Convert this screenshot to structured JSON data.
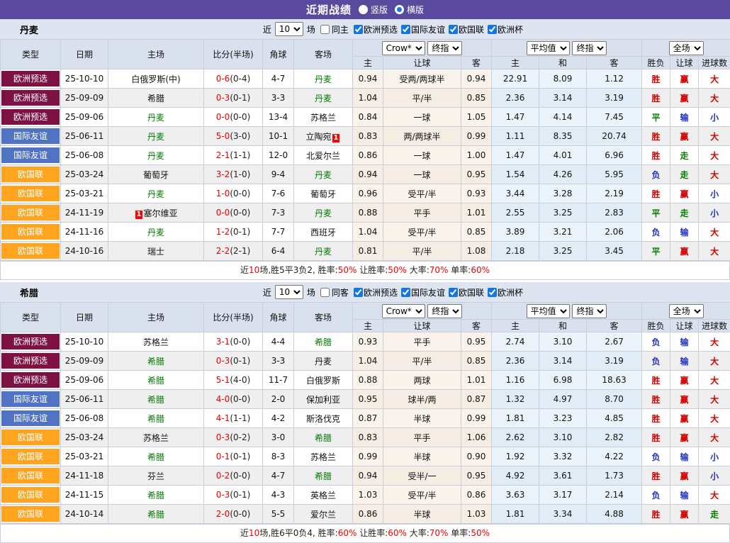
{
  "topbar": {
    "title": "近期战绩",
    "vertical_label": "竖版",
    "horizontal_label": "横版"
  },
  "common": {
    "near_label": "近",
    "count": "10",
    "matches_label": "场",
    "competitions": [
      "欧洲预选",
      "国际友谊",
      "欧国联",
      "欧洲杯"
    ],
    "columns": [
      "类型",
      "日期",
      "主场",
      "比分(半场)",
      "角球",
      "客场"
    ],
    "sub_columns": [
      "主",
      "让球",
      "客",
      "主",
      "和",
      "客",
      "胜负",
      "让球",
      "进球数"
    ],
    "selects": {
      "bookmaker": "Crow*",
      "final_a": "终指",
      "average": "平均值",
      "final_b": "终指",
      "scope": "全场"
    }
  },
  "row_fields": [
    "competition",
    "date",
    "home",
    "home_card",
    "score_full",
    "score_half",
    "corners",
    "away",
    "away_card",
    "odds_home",
    "handicap",
    "odds_away",
    "avg_home",
    "avg_draw",
    "avg_away",
    "result",
    "handicap_result",
    "goals_result"
  ],
  "sections": [
    {
      "team": "丹麦",
      "same_label": "同主",
      "rows": [
        [
          "欧洲预选",
          "25-10-10",
          "白俄罗斯(中)",
          "",
          "0-6",
          "(0-4)",
          "4-7",
          "丹麦",
          "",
          "0.94",
          "受两/两球半",
          "0.94",
          "22.91",
          "8.09",
          "1.12",
          "胜",
          "赢",
          "大"
        ],
        [
          "欧洲预选",
          "25-09-09",
          "希腊",
          "",
          "0-3",
          "(0-1)",
          "3-3",
          "丹麦",
          "",
          "1.04",
          "平/半",
          "0.85",
          "2.36",
          "3.14",
          "3.19",
          "胜",
          "赢",
          "大"
        ],
        [
          "欧洲预选",
          "25-09-06",
          "丹麦",
          "",
          "0-0",
          "(0-0)",
          "13-4",
          "苏格兰",
          "",
          "0.84",
          "一球",
          "1.05",
          "1.47",
          "4.14",
          "7.45",
          "平",
          "输",
          "小"
        ],
        [
          "国际友谊",
          "25-06-11",
          "丹麦",
          "",
          "5-0",
          "(3-0)",
          "10-1",
          "立陶宛",
          "1",
          "0.83",
          "两/两球半",
          "0.99",
          "1.11",
          "8.35",
          "20.74",
          "胜",
          "赢",
          "大"
        ],
        [
          "国际友谊",
          "25-06-08",
          "丹麦",
          "",
          "2-1",
          "(1-1)",
          "12-0",
          "北爱尔兰",
          "",
          "0.86",
          "一球",
          "1.00",
          "1.47",
          "4.01",
          "6.96",
          "胜",
          "走",
          "大"
        ],
        [
          "欧国联",
          "25-03-24",
          "葡萄牙",
          "",
          "3-2",
          "(1-0)",
          "9-4",
          "丹麦",
          "",
          "0.94",
          "一球",
          "0.95",
          "1.54",
          "4.26",
          "5.95",
          "负",
          "走",
          "大"
        ],
        [
          "欧国联",
          "25-03-21",
          "丹麦",
          "",
          "1-0",
          "(0-0)",
          "7-6",
          "葡萄牙",
          "",
          "0.96",
          "受平/半",
          "0.93",
          "3.44",
          "3.28",
          "2.19",
          "胜",
          "赢",
          "小"
        ],
        [
          "欧国联",
          "24-11-19",
          "塞尔维亚",
          "1",
          "0-0",
          "(0-0)",
          "7-3",
          "丹麦",
          "",
          "0.88",
          "平手",
          "1.01",
          "2.55",
          "3.25",
          "2.83",
          "平",
          "走",
          "小"
        ],
        [
          "欧国联",
          "24-11-16",
          "丹麦",
          "",
          "1-2",
          "(0-1)",
          "7-7",
          "西班牙",
          "",
          "1.04",
          "受平/半",
          "0.85",
          "3.89",
          "3.21",
          "2.06",
          "负",
          "输",
          "大"
        ],
        [
          "欧国联",
          "24-10-16",
          "瑞士",
          "",
          "2-2",
          "(2-1)",
          "6-4",
          "丹麦",
          "",
          "0.81",
          "平/半",
          "1.08",
          "2.18",
          "3.25",
          "3.45",
          "平",
          "赢",
          "大"
        ]
      ],
      "summary_parts": [
        "近",
        "10",
        "场,胜5平3负2, 胜率:",
        "50%",
        " 让胜率:",
        "50%",
        " 大率:",
        "70%",
        " 单率:",
        "60%"
      ]
    },
    {
      "team": "希腊",
      "same_label": "同客",
      "rows": [
        [
          "欧洲预选",
          "25-10-10",
          "苏格兰",
          "",
          "3-1",
          "(0-0)",
          "4-4",
          "希腊",
          "",
          "0.93",
          "平手",
          "0.95",
          "2.74",
          "3.10",
          "2.67",
          "负",
          "输",
          "大"
        ],
        [
          "欧洲预选",
          "25-09-09",
          "希腊",
          "",
          "0-3",
          "(0-1)",
          "3-3",
          "丹麦",
          "",
          "1.04",
          "平/半",
          "0.85",
          "2.36",
          "3.14",
          "3.19",
          "负",
          "输",
          "大"
        ],
        [
          "欧洲预选",
          "25-09-06",
          "希腊",
          "",
          "5-1",
          "(4-0)",
          "11-7",
          "白俄罗斯",
          "",
          "0.88",
          "两球",
          "1.01",
          "1.16",
          "6.98",
          "18.63",
          "胜",
          "赢",
          "大"
        ],
        [
          "国际友谊",
          "25-06-11",
          "希腊",
          "",
          "4-0",
          "(0-0)",
          "2-0",
          "保加利亚",
          "",
          "0.95",
          "球半/两",
          "0.87",
          "1.32",
          "4.97",
          "8.70",
          "胜",
          "赢",
          "大"
        ],
        [
          "国际友谊",
          "25-06-08",
          "希腊",
          "",
          "4-1",
          "(1-1)",
          "4-2",
          "斯洛伐克",
          "",
          "0.87",
          "半球",
          "0.99",
          "1.81",
          "3.23",
          "4.85",
          "胜",
          "赢",
          "大"
        ],
        [
          "欧国联",
          "25-03-24",
          "苏格兰",
          "",
          "0-3",
          "(0-2)",
          "3-0",
          "希腊",
          "",
          "0.83",
          "平手",
          "1.06",
          "2.62",
          "3.10",
          "2.82",
          "胜",
          "赢",
          "大"
        ],
        [
          "欧国联",
          "25-03-21",
          "希腊",
          "",
          "0-1",
          "(0-1)",
          "8-3",
          "苏格兰",
          "",
          "0.99",
          "半球",
          "0.90",
          "1.92",
          "3.32",
          "4.22",
          "负",
          "输",
          "小"
        ],
        [
          "欧国联",
          "24-11-18",
          "芬兰",
          "",
          "0-2",
          "(0-0)",
          "4-7",
          "希腊",
          "",
          "0.94",
          "受半/一",
          "0.95",
          "4.92",
          "3.61",
          "1.73",
          "胜",
          "赢",
          "小"
        ],
        [
          "欧国联",
          "24-11-15",
          "希腊",
          "",
          "0-3",
          "(0-1)",
          "4-3",
          "英格兰",
          "",
          "1.03",
          "受平/半",
          "0.86",
          "3.63",
          "3.17",
          "2.14",
          "负",
          "输",
          "大"
        ],
        [
          "欧国联",
          "24-10-14",
          "希腊",
          "",
          "2-0",
          "(0-0)",
          "5-5",
          "爱尔兰",
          "",
          "0.86",
          "半球",
          "1.03",
          "1.81",
          "3.34",
          "4.88",
          "胜",
          "赢",
          "走"
        ]
      ],
      "summary_parts": [
        "近",
        "10",
        "场,胜6平0负4, 胜率:",
        "60%",
        " 让胜率:",
        "60%",
        " 大率:",
        "70%",
        " 单率:",
        "50%"
      ]
    }
  ],
  "colors": {
    "topbar": "#5a4a9d",
    "comp_qualifier": "#7d1144",
    "comp_friendly": "#5173c3",
    "comp_nations": "#ffa41f",
    "comp_euro": "#7d1144",
    "win_red": "#d40000",
    "draw_green": "#007a00",
    "lose_blue": "#2233bb",
    "score_red": "#ee0000",
    "team_green": "#007a00"
  }
}
